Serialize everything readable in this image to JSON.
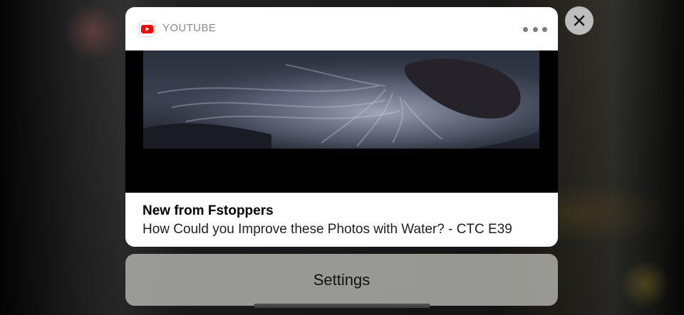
{
  "notification": {
    "app_name": "YOUTUBE",
    "app_icon": "youtube-logo-icon",
    "more_icon": "ellipsis-icon",
    "title": "New from Fstoppers",
    "body": "How Could you Improve these Photos with Water? - CTC E39",
    "thumbnail": "long-exposure-water-over-rocks-photo"
  },
  "actions": {
    "settings_label": "Settings",
    "close_icon": "close-icon"
  },
  "colors": {
    "brand_red": "#ff0000",
    "card_background": "#ffffff",
    "secondary_text": "#8a8a8e"
  }
}
